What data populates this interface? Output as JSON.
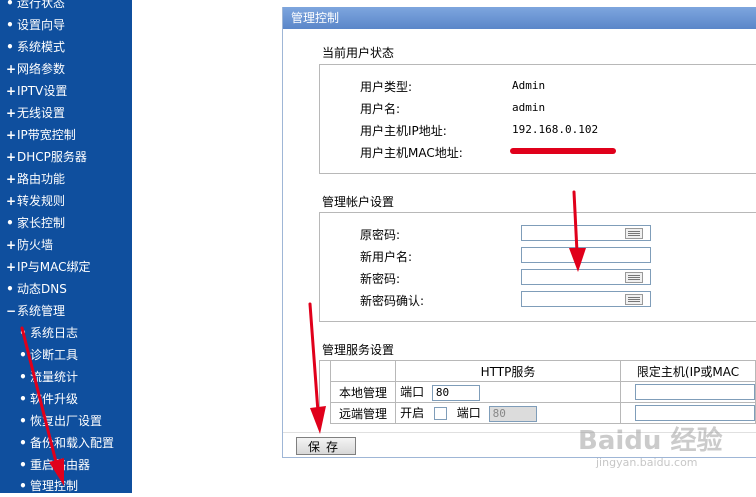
{
  "sidebar": {
    "items": [
      {
        "bullet": "•",
        "label": "运行状态"
      },
      {
        "bullet": "•",
        "label": "设置向导"
      },
      {
        "bullet": "•",
        "label": "系统模式"
      },
      {
        "bullet": "+",
        "label": "网络参数"
      },
      {
        "bullet": "+",
        "label": "IPTV设置"
      },
      {
        "bullet": "+",
        "label": "无线设置"
      },
      {
        "bullet": "+",
        "label": "IP带宽控制"
      },
      {
        "bullet": "+",
        "label": "DHCP服务器"
      },
      {
        "bullet": "+",
        "label": "路由功能"
      },
      {
        "bullet": "+",
        "label": "转发规则"
      },
      {
        "bullet": "•",
        "label": "家长控制"
      },
      {
        "bullet": "+",
        "label": "防火墙"
      },
      {
        "bullet": "+",
        "label": "IP与MAC绑定"
      },
      {
        "bullet": "•",
        "label": "动态DNS"
      },
      {
        "bullet": "−",
        "label": "系统管理"
      }
    ],
    "subitems": [
      {
        "bullet": "•",
        "label": "系统日志"
      },
      {
        "bullet": "•",
        "label": "诊断工具"
      },
      {
        "bullet": "•",
        "label": "流量统计"
      },
      {
        "bullet": "•",
        "label": "软件升级"
      },
      {
        "bullet": "•",
        "label": "恢复出厂设置"
      },
      {
        "bullet": "•",
        "label": "备份和载入配置"
      },
      {
        "bullet": "•",
        "label": "重启路由器"
      },
      {
        "bullet": "•",
        "label": "管理控制"
      }
    ]
  },
  "panel": {
    "title": "管理控制",
    "status": {
      "title": "当前用户状态",
      "user_type_label": "用户类型:",
      "user_type_value": "Admin",
      "username_label": "用户名:",
      "username_value": "admin",
      "ip_label": "用户主机IP地址:",
      "ip_value": "192.168.0.102",
      "mac_label": "用户主机MAC地址:"
    },
    "account": {
      "title": "管理帐户设置",
      "old_password_label": "原密码:",
      "new_username_label": "新用户名:",
      "new_password_label": "新密码:",
      "confirm_password_label": "新密码确认:"
    },
    "service": {
      "title": "管理服务设置",
      "col_http": "HTTP服务",
      "col_host": "限定主机(IP或MAC",
      "local_label": "本地管理",
      "remote_label": "远端管理",
      "port_label": "端口",
      "enable_label": "开启",
      "local_port": "80",
      "remote_port": "80"
    },
    "save_label": "保存"
  },
  "watermark": {
    "text": "Baidu 经验",
    "sub": "jingyan.baidu.com"
  },
  "colors": {
    "sidebar_bg": "#0f4f9e",
    "header_bg": "#6b95d4",
    "annotation": "#e0001b"
  }
}
